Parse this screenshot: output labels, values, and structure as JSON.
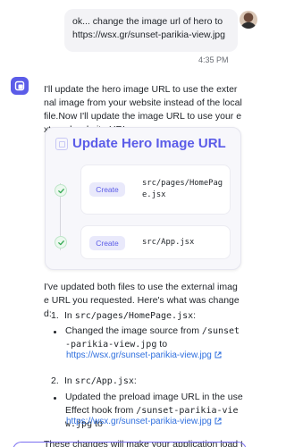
{
  "user_message": {
    "text": "ok... change the image url of hero to https://wsx.gr/sunset-parikia-view.jpg",
    "time": "4:35 PM"
  },
  "assistant": {
    "intro": "I'll update the hero image URL to use the external image from your website instead of the local file.Now I'll update the image URL to use your external website URL:",
    "card": {
      "title": "Update Hero Image URL",
      "steps": [
        {
          "action": "Create",
          "path": "src/pages/HomePage.jsx"
        },
        {
          "action": "Create",
          "path": "src/App.jsx"
        }
      ]
    },
    "summary": "I've updated both files to use the external image URL you requested. Here's what was changed:",
    "changes": [
      {
        "num": "1.",
        "prefix": "In ",
        "file": "src/pages/HomePage.jsx",
        "suffix": ":",
        "detail_text": "Changed the image source from ",
        "detail_code": "/sunset-parikia-view.jpg",
        "detail_to": " to",
        "link": "https://wsx.gr/sunset-parikia-view.jpg"
      },
      {
        "num": "2.",
        "prefix": "In ",
        "file": "src/App.jsx",
        "suffix": ":",
        "detail_text": "Updated the preload image URL in the useEffect hook from ",
        "detail_code": "/sunset-parikia-view.jpg",
        "detail_to": " to",
        "link": "https://wsx.gr/sunset-parikia-view.jpg"
      }
    ],
    "closing": "These changes will make your application load the image"
  },
  "colors": {
    "accent": "#5b5ce8",
    "link": "#2f6fde",
    "success": "#34a853"
  }
}
